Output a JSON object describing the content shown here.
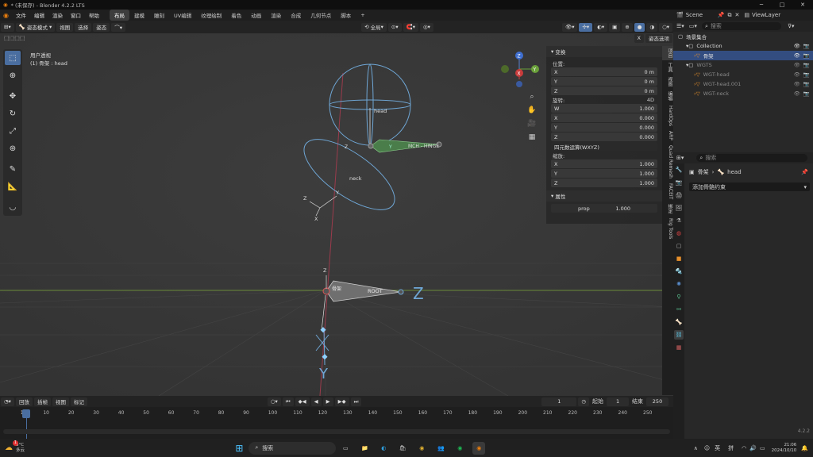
{
  "app": {
    "title": "* (未保存) - Blender 4.2.2 LTS",
    "version": "4.2.2"
  },
  "window_controls": {
    "minimize": "─",
    "maximize": "□",
    "close": "✕"
  },
  "menu": [
    "文件",
    "编辑",
    "渲染",
    "窗口",
    "帮助"
  ],
  "workspaces": [
    "布局",
    "建模",
    "雕刻",
    "UV编辑",
    "纹理绘制",
    "着色",
    "动画",
    "渲染",
    "合成",
    "几何节点",
    "脚本"
  ],
  "active_workspace": "布局",
  "add_workspace": "+",
  "header": {
    "mode": "姿态模式",
    "items": [
      "视图",
      "选择",
      "姿态"
    ],
    "transform": "全局",
    "pose_options": "姿态选项",
    "x_label": "X"
  },
  "viewport": {
    "view_name": "用户透视",
    "object_line": "(1) 骨架 : head",
    "labels": {
      "head": "head",
      "neck": "neck",
      "mch": "MCH - HINGE",
      "root": "ROOT",
      "bone_near_root": "骨架",
      "big_z": "Z",
      "big_y": "Y"
    },
    "axis_letters": {
      "z": "Z",
      "y": "Y",
      "x": "X"
    }
  },
  "gizmo": {
    "z": "Z",
    "y": "Y",
    "x": "X"
  },
  "npanel": {
    "transform_title": "变换",
    "location_label": "位置:",
    "location": [
      {
        "axis": "X",
        "value": "0 m"
      },
      {
        "axis": "Y",
        "value": "0 m"
      },
      {
        "axis": "Z",
        "value": "0 m"
      }
    ],
    "rotation_label": "旋转:",
    "rotation_mode_short": "4D",
    "rotation": [
      {
        "axis": "W",
        "value": "1.000"
      },
      {
        "axis": "X",
        "value": "0.000"
      },
      {
        "axis": "Y",
        "value": "0.000"
      },
      {
        "axis": "Z",
        "value": "0.000"
      }
    ],
    "rotation_mode": "四元数运算(WXYZ)",
    "scale_label": "缩放:",
    "scale": [
      {
        "axis": "X",
        "value": "1.000"
      },
      {
        "axis": "Y",
        "value": "1.000"
      },
      {
        "axis": "Z",
        "value": "1.000"
      }
    ],
    "properties_title": "属性",
    "prop_name": "prop",
    "prop_value": "1.000"
  },
  "sidetabs": [
    "项目",
    "工具",
    "视图",
    "编辑",
    "HardOps",
    "ARP",
    "Quad Remesh",
    "FACEIT",
    "绑定",
    "Rig Tools"
  ],
  "timeline": {
    "menus": [
      "回放",
      "插帧",
      "视图",
      "标记"
    ],
    "current_frame": "1",
    "start_label": "起始",
    "start": "1",
    "end_label": "结束",
    "end": "250",
    "ruler": [
      "1",
      "10",
      "20",
      "30",
      "40",
      "50",
      "60",
      "70",
      "80",
      "90",
      "100",
      "110",
      "120",
      "130",
      "140",
      "150",
      "160",
      "170",
      "180",
      "190",
      "200",
      "210",
      "220",
      "230",
      "240",
      "250"
    ]
  },
  "outliner": {
    "scene": "Scene",
    "view_layer": "ViewLayer",
    "search_placeholder": "搜索",
    "rows": [
      {
        "label": "场景集合",
        "indent": 0
      },
      {
        "label": "Collection",
        "indent": 1
      },
      {
        "label": "骨架",
        "indent": 2,
        "selected": true
      },
      {
        "label": "WGTS",
        "indent": 1,
        "muted": true
      },
      {
        "label": "WGT-head",
        "indent": 2,
        "muted": true
      },
      {
        "label": "WGT-head.001",
        "indent": 2,
        "muted": true
      },
      {
        "label": "WGT-neck",
        "indent": 2,
        "muted": true
      }
    ]
  },
  "properties": {
    "search_placeholder": "搜索",
    "breadcrumb_obj": "骨架",
    "breadcrumb_bone": "head",
    "add_constraint": "添加骨骼约束"
  },
  "taskbar": {
    "weather_temp": "9°C",
    "weather_text": "多云",
    "search": "搜索",
    "lang": "英",
    "ime": "拼",
    "time": "21:06",
    "date": "2024/10/10",
    "badge": "1"
  }
}
